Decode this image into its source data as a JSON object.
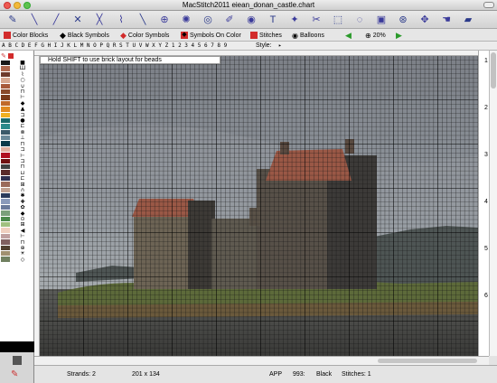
{
  "window": {
    "title": "MacStitch2011  eiean_donan_castle.chart"
  },
  "toolbar": {
    "tools": [
      {
        "name": "pen-tool",
        "glyph": "✎"
      },
      {
        "name": "half-stitch-tool",
        "glyph": "╲"
      },
      {
        "name": "quarter-stitch-tool",
        "glyph": "╱"
      },
      {
        "name": "backstitch-tool",
        "glyph": "✕"
      },
      {
        "name": "long-stitch-tool",
        "glyph": "╳"
      },
      {
        "name": "bead-tool",
        "glyph": "⌇"
      },
      {
        "name": "line-tool",
        "glyph": "╲"
      },
      {
        "name": "fill-tool",
        "glyph": "⊕"
      },
      {
        "name": "knot-tool",
        "glyph": "✺"
      },
      {
        "name": "circle-tool",
        "glyph": "◎"
      },
      {
        "name": "brush-tool",
        "glyph": "✐"
      },
      {
        "name": "eye-tool",
        "glyph": "◉"
      },
      {
        "name": "text-tool",
        "glyph": "T"
      },
      {
        "name": "magic-wand-tool",
        "glyph": "✦"
      },
      {
        "name": "scissors-tool",
        "glyph": "✂"
      },
      {
        "name": "select-tool",
        "glyph": "⬚"
      },
      {
        "name": "lasso-tool",
        "glyph": "◌"
      },
      {
        "name": "stamp-tool",
        "glyph": "▣"
      },
      {
        "name": "zoom-tool",
        "glyph": "⊛"
      },
      {
        "name": "move-tool",
        "glyph": "✥"
      },
      {
        "name": "hand-tool",
        "glyph": "☚"
      },
      {
        "name": "eraser-tool",
        "glyph": "▰"
      }
    ]
  },
  "modebar": {
    "color_blocks": "Color Blocks",
    "black_symbols": "Black Symbols",
    "color_symbols": "Color Symbols",
    "symbols_on_color": "Symbols On Color",
    "stitches": "Stitches",
    "balloons": "Balloons",
    "zoom": "20%"
  },
  "letters": "A B C D E F G H I J K L M N O P Q R S T U V W X Y Z 1 2 3 4 5 6 7 8 9",
  "style_label": "Style:",
  "hint": "Hold SHIFT to use brick layout for beads",
  "palette": {
    "colors": [
      "#1a1a1a",
      "#b06a50",
      "#6e3a2a",
      "#d8a890",
      "#a85a3a",
      "#8a4a2a",
      "#7a3a1a",
      "#c06a2a",
      "#e08a20",
      "#f0b020",
      "#1a6a6a",
      "#2a8a8a",
      "#3a5a6a",
      "#6a8a9a",
      "#0a3a4a",
      "#e0b0a0",
      "#b01020",
      "#701010",
      "#404040",
      "#5a2a2a",
      "#303050",
      "#9a6a5a",
      "#c0a090",
      "#2a3a5a",
      "#8a9aba",
      "#6a7a9a",
      "#7aa07a",
      "#4a8a4a",
      "#a0c080",
      "#f0d0c0",
      "#c0a0a0",
      "#806060",
      "#504030",
      "#a09070",
      "#708060"
    ],
    "symbols": [
      "■",
      "Ш",
      "⌇",
      "○",
      "∪",
      "⊓",
      "⊢",
      "◆",
      "▲",
      "⊐",
      "●",
      "⊏",
      "⊗",
      "⊥",
      "⊓",
      "⊐",
      "⊢",
      "⊐",
      "⊓",
      "⊔",
      "⊏",
      "⊞",
      "∩",
      "✱",
      "✚",
      "✿",
      "◆",
      "⊙",
      "⊞",
      "◀",
      "⊢",
      "⊓",
      "⊕",
      "☀",
      "◇"
    ]
  },
  "ruler_right": [
    "1",
    "2",
    "3",
    "4",
    "5",
    "6"
  ],
  "status": {
    "strands": "Strands:  2",
    "size": "201 x 134",
    "brand": "APP",
    "code": "993:",
    "color_name": "Black",
    "stitches": "Stitches: 1"
  },
  "colors": {
    "accent_red": "#d22b2b",
    "toolbar_bg": "#d9d9d9",
    "grid": "#111111"
  }
}
